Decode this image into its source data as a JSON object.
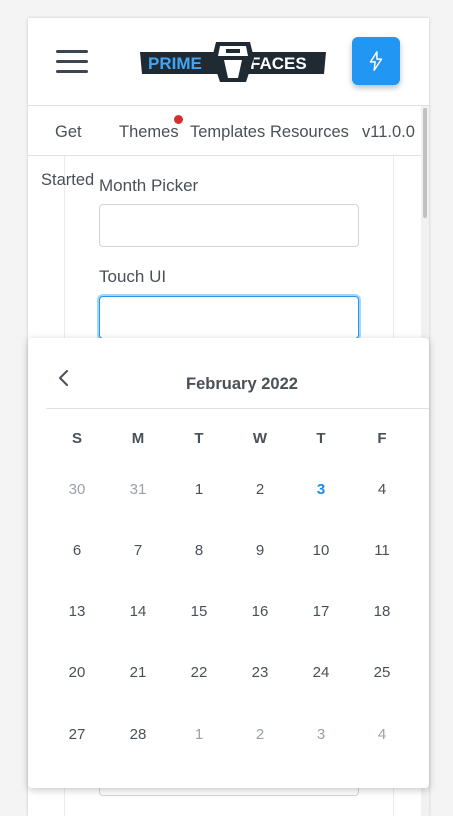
{
  "topbar": {
    "logo_text_left": "PRIME",
    "logo_text_right": "FACES",
    "menu_icon": "hamburger-icon",
    "action_icon": "bolt-icon",
    "accent_color": "#2196f3"
  },
  "menubar": {
    "items": [
      {
        "label": "Get",
        "badge": false
      },
      {
        "label": "Themes",
        "badge": true
      },
      {
        "label": "Templates",
        "badge": false
      },
      {
        "label": "Resources",
        "badge": false
      },
      {
        "label": "v11.0.0",
        "badge": false
      }
    ],
    "wrapped_text": "Started"
  },
  "form": {
    "month_picker_label": "Month Picker",
    "month_picker_value": "",
    "touch_ui_label": "Touch UI",
    "touch_ui_value": ""
  },
  "datepicker": {
    "title": "February 2022",
    "prev_icon": "chevron-left-icon",
    "weekdays": [
      "S",
      "M",
      "T",
      "W",
      "T",
      "F"
    ],
    "weeks": [
      [
        {
          "d": "30",
          "o": true
        },
        {
          "d": "31",
          "o": true
        },
        {
          "d": "1"
        },
        {
          "d": "2"
        },
        {
          "d": "3",
          "today": true
        },
        {
          "d": "4"
        }
      ],
      [
        {
          "d": "6"
        },
        {
          "d": "7"
        },
        {
          "d": "8"
        },
        {
          "d": "9"
        },
        {
          "d": "10"
        },
        {
          "d": "11"
        }
      ],
      [
        {
          "d": "13"
        },
        {
          "d": "14"
        },
        {
          "d": "15"
        },
        {
          "d": "16"
        },
        {
          "d": "17"
        },
        {
          "d": "18"
        }
      ],
      [
        {
          "d": "20"
        },
        {
          "d": "21"
        },
        {
          "d": "22"
        },
        {
          "d": "23"
        },
        {
          "d": "24"
        },
        {
          "d": "25"
        }
      ],
      [
        {
          "d": "27"
        },
        {
          "d": "28"
        },
        {
          "d": "1",
          "o": true
        },
        {
          "d": "2",
          "o": true
        },
        {
          "d": "3",
          "o": true
        },
        {
          "d": "4",
          "o": true
        }
      ]
    ]
  }
}
